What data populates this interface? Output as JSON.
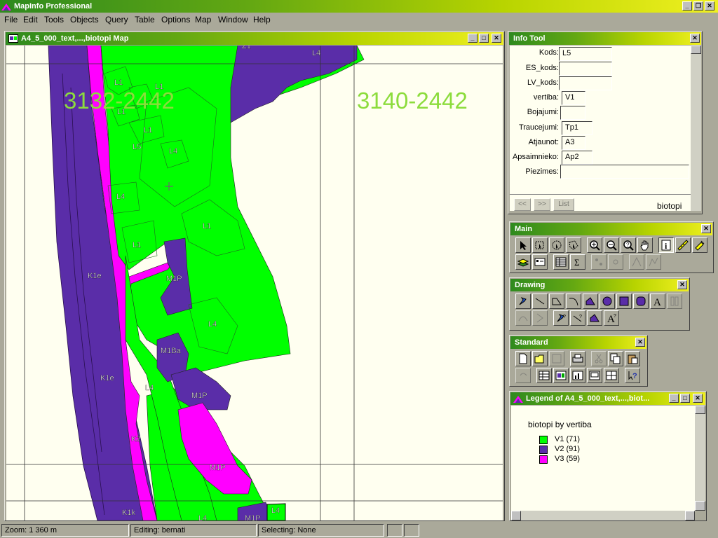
{
  "app": {
    "title": "MapInfo Professional"
  },
  "menu": [
    "File",
    "Edit",
    "Tools",
    "Objects",
    "Query",
    "Table",
    "Options",
    "Map",
    "Window",
    "Help"
  ],
  "map_window": {
    "title": "A4_5_000_text,...,biotopi Map",
    "grid_labels": [
      "3132-2442",
      "3140-2442"
    ],
    "region_labels": {
      "l4_top": "L4",
      "l1_a": "L1",
      "l1_b": "L1",
      "l1_c": "L1",
      "l1_d": "L1",
      "l5": "L5",
      "l4_b": "L4",
      "l4_c": "L4",
      "l1_e": "L1",
      "l1_f": "L1",
      "k1e_a": "K1e",
      "m1p_a": "M1P",
      "l4_d": "L4",
      "m1ba": "M1Ba",
      "k1e_b": "K1e",
      "l4_e": "L4",
      "m1p_b": "M1P",
      "k2": "K2",
      "m1p_c": "M1P",
      "k1k": "K1k",
      "l4_f": "L4",
      "l4_g": "L4",
      "m1p_d": "M1P",
      "z1": "Z1"
    },
    "colors": {
      "v1": "#00ff00",
      "v2": "#5a2da8",
      "v3": "#ff00ff",
      "bg": "#fffff0"
    }
  },
  "info_tool": {
    "title": "Info Tool",
    "fields": [
      {
        "label": "Kods:",
        "value": "L5"
      },
      {
        "label": "ES_kods:",
        "value": ""
      },
      {
        "label": "LV_kods:",
        "value": ""
      },
      {
        "label": "vertiba:",
        "value": "V1"
      },
      {
        "label": "Bojajumi:",
        "value": ""
      },
      {
        "label": "Traucejumi:",
        "value": "Tp1"
      },
      {
        "label": "Atjaunot:",
        "value": "A3"
      },
      {
        "label": "Apsaimnieko:",
        "value": "Ap2"
      },
      {
        "label": "Piezimes:",
        "value": ""
      }
    ],
    "buttons": {
      "prev": "<<",
      "next": ">>",
      "list": "List"
    },
    "layer": "biotopi"
  },
  "toolbars": {
    "main": "Main",
    "drawing": "Drawing",
    "standard": "Standard"
  },
  "legend": {
    "title": "Legend of A4_5_000_text,...,biot...",
    "heading": "biotopi by vertiba",
    "items": [
      {
        "label": "V1  (71)",
        "color": "#00ff00"
      },
      {
        "label": "V2  (91)",
        "color": "#5a2da8"
      },
      {
        "label": "V3  (59)",
        "color": "#ff00ff"
      }
    ]
  },
  "status": {
    "zoom": "Zoom: 1 360 m",
    "editing": "Editing: bernati",
    "selecting": "Selecting: None"
  }
}
